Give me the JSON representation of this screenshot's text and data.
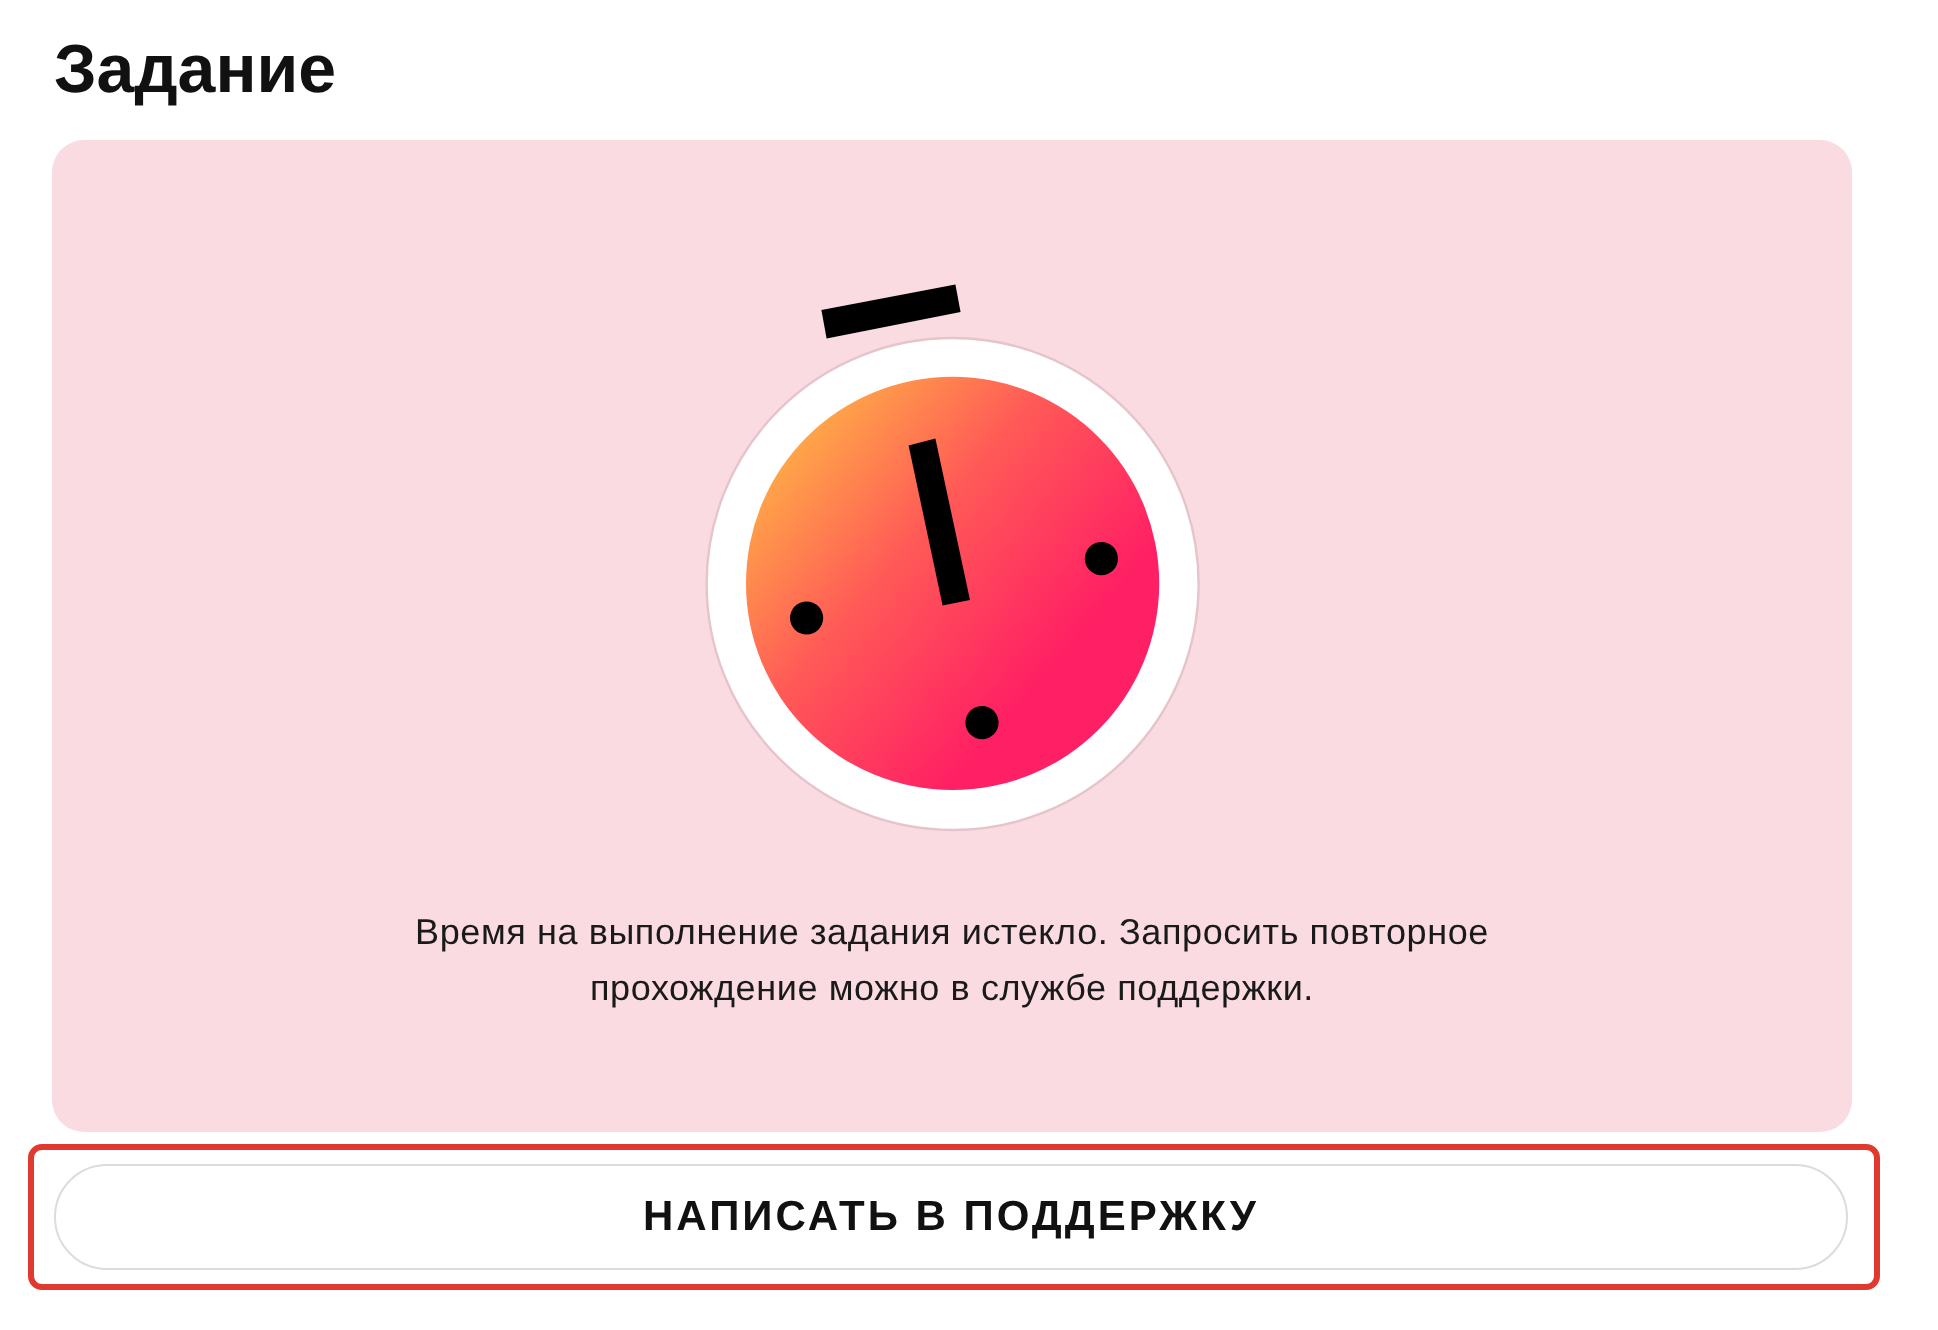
{
  "page": {
    "title": "Задание"
  },
  "notice": {
    "message": "Время на выполнение задания истекло. Запросить повторное прохождение можно в службе поддержки."
  },
  "support_button": {
    "label": "НАПИСАТЬ В ПОДДЕРЖКУ",
    "highlighted": true
  }
}
